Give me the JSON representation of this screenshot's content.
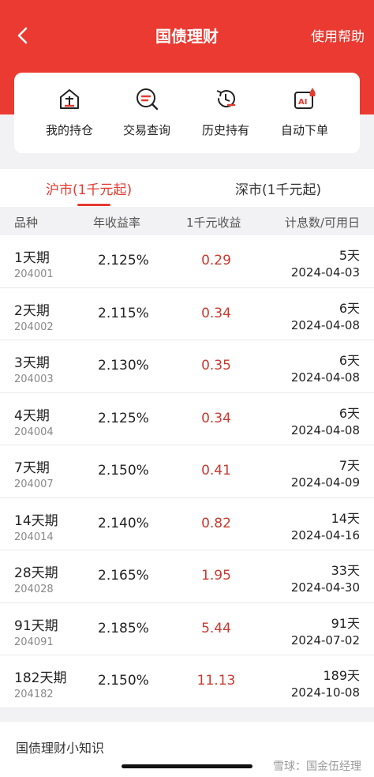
{
  "header": {
    "title": "国债理财",
    "help": "使用帮助",
    "back_icon": "chevron-left-icon",
    "bg_color": "#ea3a31"
  },
  "shortcuts": [
    {
      "label": "我的持仓",
      "icon": "holdings-icon"
    },
    {
      "label": "交易查询",
      "icon": "search-icon"
    },
    {
      "label": "历史持有",
      "icon": "history-icon"
    },
    {
      "label": "自动下单",
      "icon": "ai-auto-order-icon"
    }
  ],
  "tabs": [
    {
      "label": "沪市(1千元起)",
      "active": true
    },
    {
      "label": "深市(1千元起)",
      "active": false
    }
  ],
  "columns": {
    "name": "品种",
    "rate": "年收益率",
    "income": "1千元收益",
    "days": "计息数/可用日"
  },
  "rows": [
    {
      "name": "1天期",
      "code": "204001",
      "rate": "2.125%",
      "income": "0.29",
      "days": "5天",
      "date": "2024-04-03"
    },
    {
      "name": "2天期",
      "code": "204002",
      "rate": "2.115%",
      "income": "0.34",
      "days": "6天",
      "date": "2024-04-08"
    },
    {
      "name": "3天期",
      "code": "204003",
      "rate": "2.130%",
      "income": "0.35",
      "days": "6天",
      "date": "2024-04-08"
    },
    {
      "name": "4天期",
      "code": "204004",
      "rate": "2.125%",
      "income": "0.34",
      "days": "6天",
      "date": "2024-04-08"
    },
    {
      "name": "7天期",
      "code": "204007",
      "rate": "2.150%",
      "income": "0.41",
      "days": "7天",
      "date": "2024-04-09"
    },
    {
      "name": "14天期",
      "code": "204014",
      "rate": "2.140%",
      "income": "0.82",
      "days": "14天",
      "date": "2024-04-16"
    },
    {
      "name": "28天期",
      "code": "204028",
      "rate": "2.165%",
      "income": "1.95",
      "days": "33天",
      "date": "2024-04-30"
    },
    {
      "name": "91天期",
      "code": "204091",
      "rate": "2.185%",
      "income": "5.44",
      "days": "91天",
      "date": "2024-07-02"
    },
    {
      "name": "182天期",
      "code": "204182",
      "rate": "2.150%",
      "income": "11.13",
      "days": "189天",
      "date": "2024-10-08"
    }
  ],
  "tips": {
    "title": "国债理财小知识"
  },
  "watermark": "雪球：国金伍经理"
}
